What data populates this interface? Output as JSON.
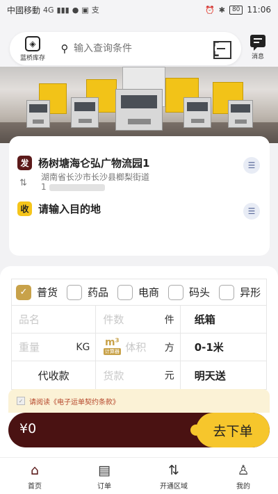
{
  "status_bar": {
    "carrier": "中國移動",
    "network": "4G",
    "time": "11:06",
    "battery": "80"
  },
  "header": {
    "logo_label": "蓝桥库存",
    "search_placeholder": "输入查询条件",
    "message_label": "消息"
  },
  "address": {
    "from_tag": "发",
    "from_name": "杨树塘海仑弘广物流园1",
    "from_addr": "湖南省长沙市长沙县榔梨街道",
    "from_phone": "1",
    "to_tag": "收",
    "to_placeholder": "请输入目的地"
  },
  "cargo_types": [
    {
      "label": "普货",
      "checked": true
    },
    {
      "label": "药品",
      "checked": false
    },
    {
      "label": "电商",
      "checked": false
    },
    {
      "label": "码头",
      "checked": false
    },
    {
      "label": "异形",
      "checked": false
    }
  ],
  "fields": {
    "name_placeholder": "品名",
    "count_placeholder": "件数",
    "count_unit": "件",
    "package_value": "纸箱",
    "weight_placeholder": "重量",
    "weight_unit": "KG",
    "calc_top": "m³",
    "calc_bottom": "计算器",
    "volume_placeholder": "体积",
    "volume_unit": "方",
    "length_value": "0-1米",
    "cod_label": "代收款",
    "payment_placeholder": "货款",
    "payment_unit": "元",
    "delivery_value": "明天送"
  },
  "agreement": {
    "text": "请阅读《电子运单契约条款》"
  },
  "order": {
    "price": "¥0",
    "button_label": "去下单"
  },
  "nav": [
    {
      "label": "首页",
      "icon": "home-icon",
      "active": true
    },
    {
      "label": "订单",
      "icon": "orders-icon",
      "active": false
    },
    {
      "label": "开通区域",
      "icon": "region-icon",
      "active": false
    },
    {
      "label": "我的",
      "icon": "profile-icon",
      "active": false
    }
  ],
  "colors": {
    "brand_dark": "#4a1212",
    "accent_yellow": "#f6c62c",
    "gold": "#c8a24a"
  }
}
